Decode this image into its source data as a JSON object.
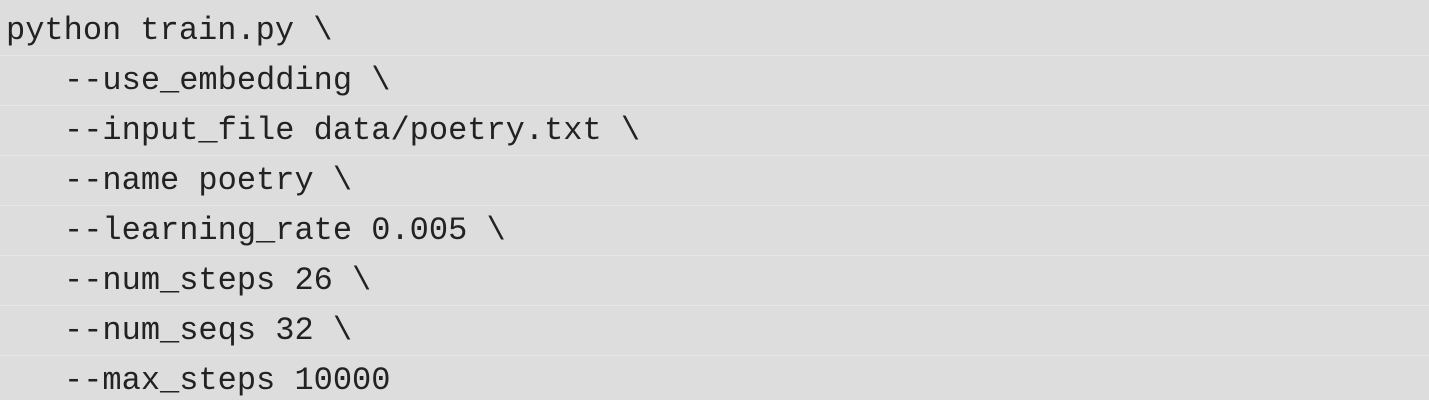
{
  "code": {
    "lines": [
      "python train.py \\",
      "--use_embedding \\",
      "--input_file data/poetry.txt \\",
      "--name poetry \\",
      "--learning_rate 0.005 \\",
      "--num_steps 26 \\",
      "--num_seqs 32 \\",
      "--max_steps 10000"
    ]
  }
}
